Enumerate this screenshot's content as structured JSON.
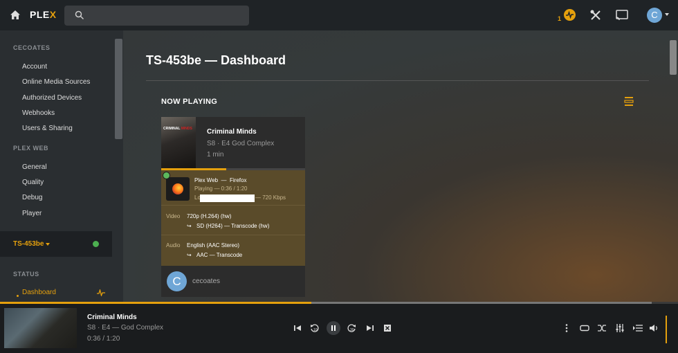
{
  "brand": {
    "logo_text": "PLE",
    "logo_x": "X",
    "accent": "#e5a00d"
  },
  "search": {
    "placeholder": ""
  },
  "topbar": {
    "activity_count": "1",
    "avatar_letter": "C"
  },
  "sidebar": {
    "section1": "CECOATES",
    "items1": [
      "Account",
      "Online Media Sources",
      "Authorized Devices",
      "Webhooks",
      "Users & Sharing"
    ],
    "section2": "PLEX WEB",
    "items2": [
      "General",
      "Quality",
      "Debug",
      "Player"
    ],
    "server": "TS-453be",
    "section3": "STATUS",
    "status_item": "Dashboard"
  },
  "main": {
    "title": "TS-453be — Dashboard",
    "now_playing": "NOW PLAYING"
  },
  "session": {
    "poster_text_a": "CRIMINAL ",
    "poster_text_b": "MINDS",
    "title": "Criminal Minds",
    "subtitle": "S8 · E4 God Complex",
    "remaining": "1 min",
    "progress": 0.45,
    "player": "Plex Web",
    "player_sep": "—",
    "browser": "Firefox",
    "state": "Playing — 0:36 / 1:20",
    "location_prefix": "Local (",
    "bandwidth": "— 720 Kbps",
    "video_label": "Video",
    "video_source": "720p (H.264) (hw)",
    "video_target": "SD (H264) — Transcode (hw)",
    "audio_label": "Audio",
    "audio_source": "English (AAC Stereo)",
    "audio_target": "AAC — Transcode",
    "arrow": "↪",
    "user_letter": "C",
    "user": "cecoates"
  },
  "player": {
    "title": "Criminal Minds",
    "subtitle": "S8 · E4 — God Complex",
    "time": "0:36 / 1:20",
    "progress": 0.459,
    "skip_back": "10",
    "skip_fwd": "30"
  }
}
